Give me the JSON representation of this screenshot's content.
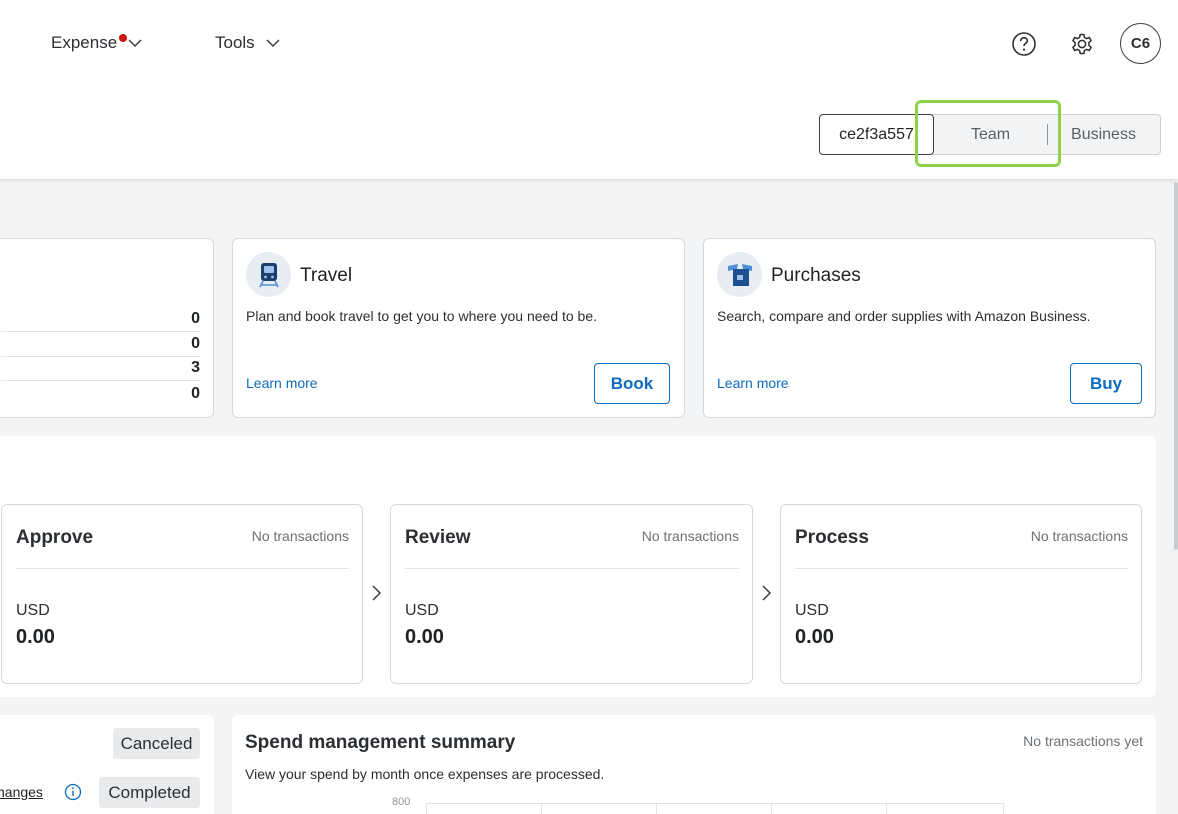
{
  "nav": {
    "expense": "Expense",
    "tools": "Tools"
  },
  "header_icons": [
    "help-icon",
    "gear-icon"
  ],
  "user": {
    "initials": "C6"
  },
  "view_switch": {
    "id_label": "ce2f3a557",
    "team_label": "Team",
    "business_label": "Business"
  },
  "counts": [
    "0",
    "0",
    "3",
    "0"
  ],
  "travel": {
    "title": "Travel",
    "desc": "Plan and book travel to get you to where you need to be.",
    "learn_more": "Learn more",
    "action": "Book"
  },
  "purchases": {
    "title": "Purchases",
    "desc": "Search, compare and order supplies with Amazon Business.",
    "learn_more": "Learn more",
    "action": "Buy"
  },
  "stages": [
    {
      "title": "Approve",
      "status": "No transactions",
      "currency": "USD",
      "amount": "0.00"
    },
    {
      "title": "Review",
      "status": "No transactions",
      "currency": "USD",
      "amount": "0.00"
    },
    {
      "title": "Process",
      "status": "No transactions",
      "currency": "USD",
      "amount": "0.00"
    }
  ],
  "status_list": {
    "canceled": "Canceled",
    "changes_link": "changes",
    "completed": "Completed"
  },
  "spend": {
    "title": "Spend management summary",
    "status": "No transactions yet",
    "desc": "View your spend by month once expenses are processed.",
    "y_tick": "800"
  },
  "colors": {
    "accent": "#0b6bc1",
    "highlight": "#8dd24a",
    "notice": "#d0160a"
  }
}
